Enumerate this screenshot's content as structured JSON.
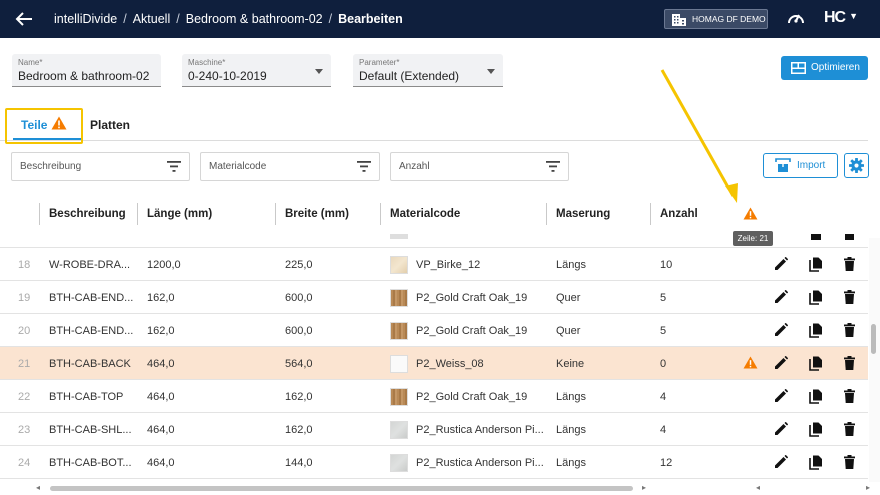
{
  "header": {
    "breadcrumbs": [
      "intelliDivide",
      "Aktuell",
      "Bedroom & bathroom-02",
      "Bearbeiten"
    ],
    "demo_label": "HOMAG DF DEMO",
    "logo_text": "HC"
  },
  "form": {
    "name": {
      "label": "Name*",
      "value": "Bedroom & bathroom-02"
    },
    "maschine": {
      "label": "Maschine*",
      "value": "0-240-10-2019"
    },
    "parameter": {
      "label": "Parameter*",
      "value": "Default (Extended)"
    },
    "optimize_label": "Optimieren"
  },
  "tabs": {
    "teile": "Teile",
    "platten": "Platten"
  },
  "filters": {
    "beschreibung": "Beschreibung",
    "materialcode": "Materialcode",
    "anzahl": "Anzahl",
    "import_label": "Import"
  },
  "table": {
    "headers": {
      "beschreibung": "Beschreibung",
      "laenge": "Länge (mm)",
      "breite": "Breite (mm)",
      "materialcode": "Materialcode",
      "maserung": "Maserung",
      "anzahl": "Anzahl"
    },
    "tooltip": "Zeile: 21",
    "rows": [
      {
        "nr": "18",
        "beschreibung": "W-ROBE-DRA...",
        "laenge": "1200,0",
        "breite": "225,0",
        "material": "VP_Birke_12",
        "maserung": "Längs",
        "anzahl": "10"
      },
      {
        "nr": "19",
        "beschreibung": "BTH-CAB-END...",
        "laenge": "162,0",
        "breite": "600,0",
        "material": "P2_Gold Craft Oak_19",
        "maserung": "Quer",
        "anzahl": "5"
      },
      {
        "nr": "20",
        "beschreibung": "BTH-CAB-END...",
        "laenge": "162,0",
        "breite": "600,0",
        "material": "P2_Gold Craft Oak_19",
        "maserung": "Quer",
        "anzahl": "5"
      },
      {
        "nr": "21",
        "beschreibung": "BTH-CAB-BACK",
        "laenge": "464,0",
        "breite": "564,0",
        "material": "P2_Weiss_08",
        "maserung": "Keine",
        "anzahl": "0"
      },
      {
        "nr": "22",
        "beschreibung": "BTH-CAB-TOP",
        "laenge": "464,0",
        "breite": "162,0",
        "material": "P2_Gold Craft Oak_19",
        "maserung": "Längs",
        "anzahl": "4"
      },
      {
        "nr": "23",
        "beschreibung": "BTH-CAB-SHL...",
        "laenge": "464,0",
        "breite": "162,0",
        "material": "P2_Rustica Anderson Pi...",
        "maserung": "Längs",
        "anzahl": "4"
      },
      {
        "nr": "24",
        "beschreibung": "BTH-CAB-BOT...",
        "laenge": "464,0",
        "breite": "144,0",
        "material": "P2_Rustica Anderson Pi...",
        "maserung": "Längs",
        "anzahl": "12"
      }
    ]
  },
  "colors": {
    "navbar": "#0f1f3d",
    "accent": "#1e8fd6",
    "warning": "#f57c00",
    "highlight_row": "#fbe4d1",
    "annotation": "#f5c400"
  }
}
